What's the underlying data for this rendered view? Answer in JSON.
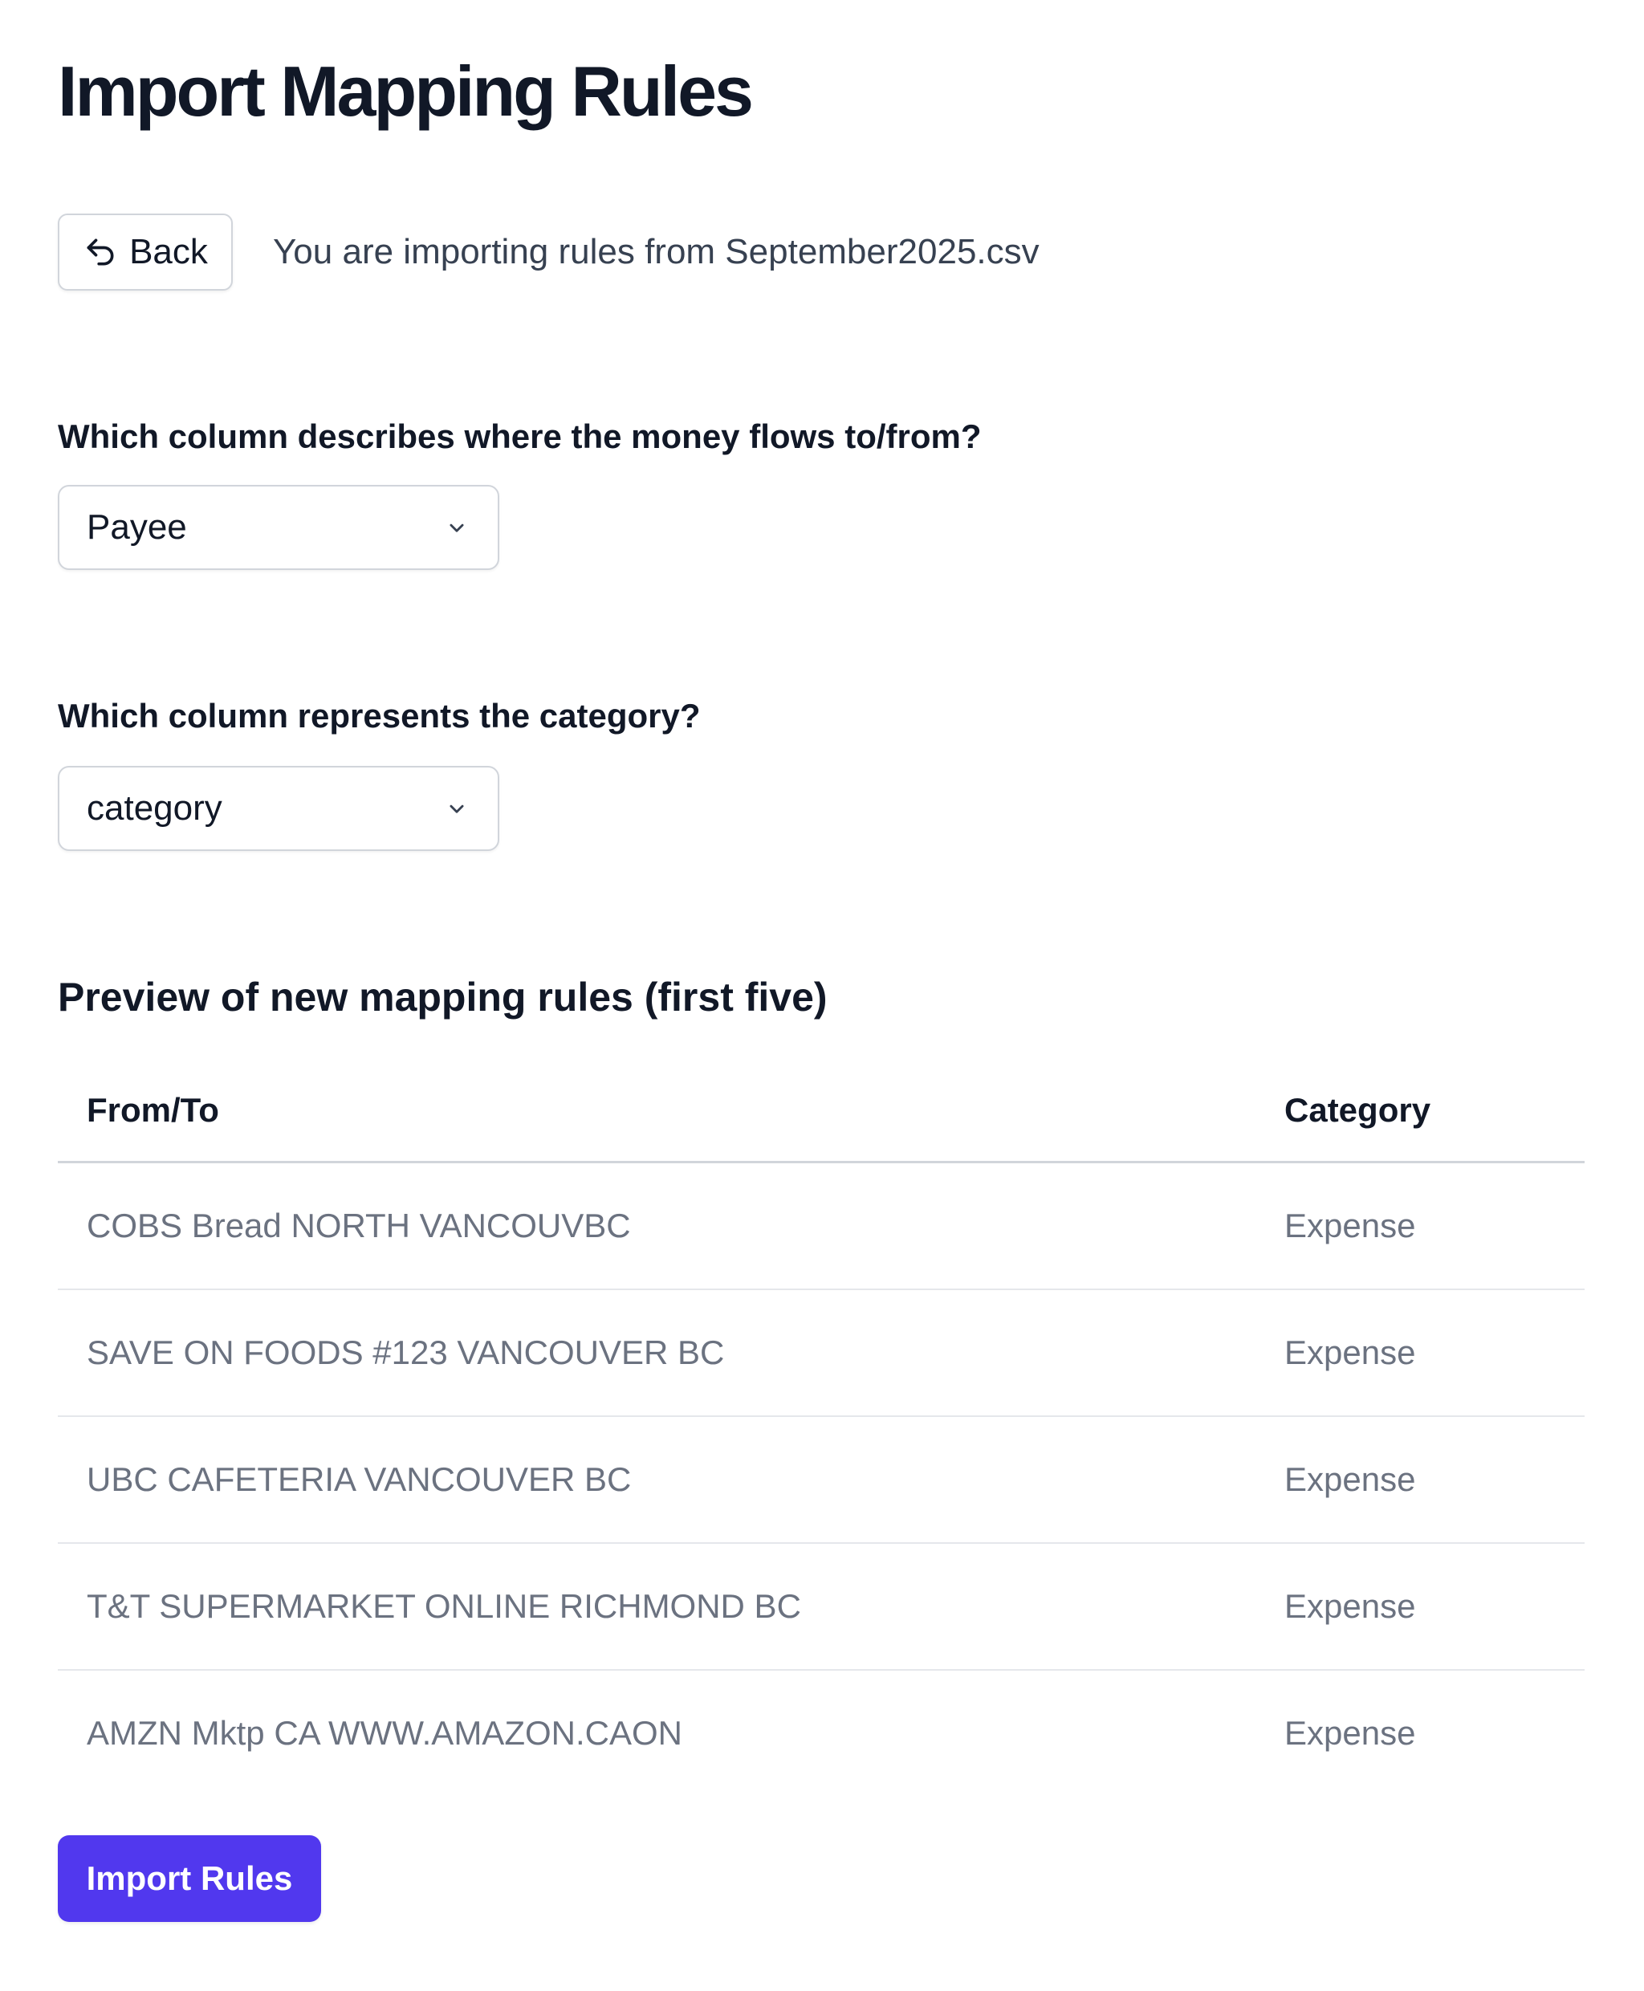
{
  "page": {
    "title": "Import Mapping Rules"
  },
  "header": {
    "back_label": "Back",
    "back_icon": "undo-arrow-icon",
    "import_info": "You are importing rules from September2025.csv"
  },
  "form": {
    "payee_question": "Which column describes where the money flows to/from?",
    "payee_select_value": "Payee",
    "category_question": "Which column represents the category?",
    "category_select_value": "category",
    "select_icon": "chevron-down-icon"
  },
  "preview": {
    "heading": "Preview of new mapping rules (first five)",
    "columns": [
      "From/To",
      "Category"
    ],
    "rows": [
      {
        "from_to": "COBS Bread NORTH VANCOUVBC",
        "category": "Expense"
      },
      {
        "from_to": "SAVE ON FOODS #123 VANCOUVER BC",
        "category": "Expense"
      },
      {
        "from_to": "UBC CAFETERIA VANCOUVER BC",
        "category": "Expense"
      },
      {
        "from_to": "T&T SUPERMARKET ONLINE RICHMOND BC",
        "category": "Expense"
      },
      {
        "from_to": "AMZN Mktp CA WWW.AMAZON.CAON",
        "category": "Expense"
      }
    ]
  },
  "actions": {
    "import_label": "Import Rules"
  },
  "colors": {
    "primary": "#5138ee",
    "text": "#111827",
    "muted_text": "#6b7280",
    "border": "#d1d5db"
  }
}
